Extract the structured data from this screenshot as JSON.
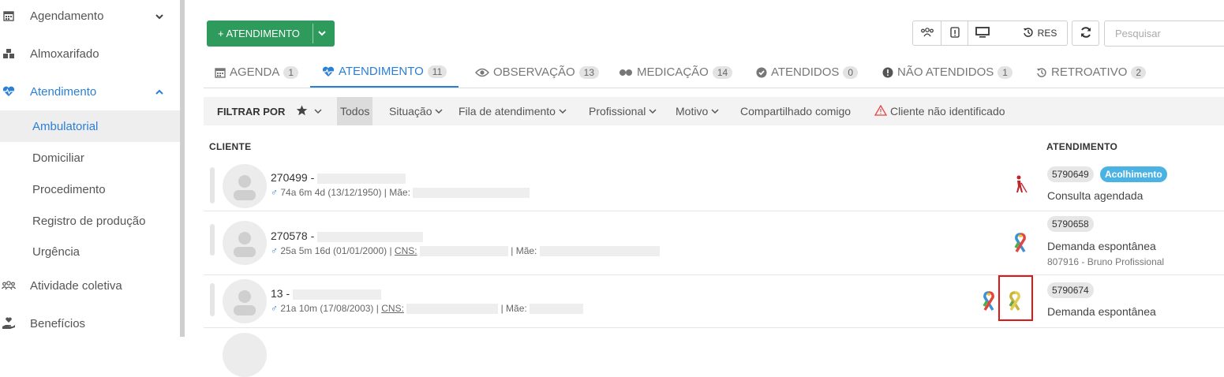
{
  "sidebar": {
    "items": [
      {
        "label": "Agendamento",
        "icon": "calendar-icon"
      },
      {
        "label": "Almoxarifado",
        "icon": "boxes-icon"
      },
      {
        "label": "Atendimento",
        "icon": "heartbeat-icon"
      },
      {
        "label": "Atividade coletiva",
        "icon": "group-icon"
      },
      {
        "label": "Benefícios",
        "icon": "hand-heart-icon"
      }
    ],
    "subitems": [
      "Ambulatorial",
      "Domiciliar",
      "Procedimento",
      "Registro de produção",
      "Urgência"
    ]
  },
  "toolbar": {
    "new_button": "+ ATENDIMENTO",
    "res_label": "RES",
    "search_placeholder": "Pesquisar"
  },
  "tabs": [
    {
      "label": "AGENDA",
      "count": "1"
    },
    {
      "label": "ATENDIMENTO",
      "count": "11"
    },
    {
      "label": "OBSERVAÇÃO",
      "count": "13"
    },
    {
      "label": "MEDICAÇÃO",
      "count": "14"
    },
    {
      "label": "ATENDIDOS",
      "count": "0"
    },
    {
      "label": "NÃO ATENDIDOS",
      "count": "1"
    },
    {
      "label": "RETROATIVO",
      "count": "2"
    }
  ],
  "filters": {
    "label": "FILTRAR POR",
    "todos": "Todos",
    "situacao": "Situação",
    "fila": "Fila de atendimento",
    "profissional": "Profissional",
    "motivo": "Motivo",
    "compartilhado": "Compartilhado comigo",
    "nao_identificado": "Cliente não identificado"
  },
  "table": {
    "col_cliente": "CLIENTE",
    "col_atendimento": "ATENDIMENTO",
    "rows": [
      {
        "name": "270499 -",
        "age": "74a 6m 4d (13/12/1950) | Mãe:",
        "cns": "",
        "code": "5790649",
        "badge": "Acolhimento",
        "type": "Consulta agendada",
        "prof": ""
      },
      {
        "name": "270578 -",
        "age": "25a 5m 16d (01/01/2000) |",
        "cns": "CNS:",
        "mae": "| Mãe:",
        "code": "5790658",
        "type": "Demanda espontânea",
        "prof": "807916 - Bruno Profissional"
      },
      {
        "name": "13 -",
        "age": "21a 10m (17/08/2003) |",
        "cns": "CNS:",
        "mae": "| Mãe:",
        "code": "5790674",
        "type": "Demanda espontânea",
        "prof": ""
      }
    ]
  },
  "colors": {
    "accent": "#2a7fd6",
    "green": "#2e9a5c",
    "badge": "#4bb3e3",
    "highlight": "#e01616"
  }
}
